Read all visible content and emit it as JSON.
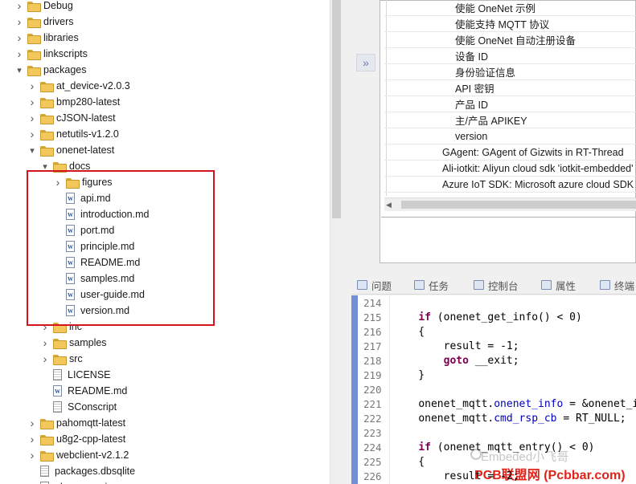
{
  "tree": {
    "items": [
      {
        "label": "Debug",
        "type": "folder",
        "expanded": false
      },
      {
        "label": "drivers",
        "type": "folder",
        "expanded": false
      },
      {
        "label": "libraries",
        "type": "folder",
        "expanded": false
      },
      {
        "label": "linkscripts",
        "type": "folder",
        "expanded": false
      },
      {
        "label": "packages",
        "type": "folder",
        "expanded": true
      },
      {
        "label": "at_device-v2.0.3",
        "type": "folder",
        "expanded": false
      },
      {
        "label": "bmp280-latest",
        "type": "folder",
        "expanded": false
      },
      {
        "label": "cJSON-latest",
        "type": "folder",
        "expanded": false
      },
      {
        "label": "netutils-v1.2.0",
        "type": "folder",
        "expanded": false
      },
      {
        "label": "onenet-latest",
        "type": "folder",
        "expanded": true
      },
      {
        "label": "docs",
        "type": "folder",
        "expanded": true
      },
      {
        "label": "figures",
        "type": "folder",
        "expanded": false
      },
      {
        "label": "api.md",
        "type": "doc"
      },
      {
        "label": "introduction.md",
        "type": "doc"
      },
      {
        "label": "port.md",
        "type": "doc"
      },
      {
        "label": "principle.md",
        "type": "doc"
      },
      {
        "label": "README.md",
        "type": "doc"
      },
      {
        "label": "samples.md",
        "type": "doc"
      },
      {
        "label": "user-guide.md",
        "type": "doc"
      },
      {
        "label": "version.md",
        "type": "doc"
      },
      {
        "label": "inc",
        "type": "folder",
        "expanded": false
      },
      {
        "label": "samples",
        "type": "folder",
        "expanded": false
      },
      {
        "label": "src",
        "type": "folder",
        "expanded": false
      },
      {
        "label": "LICENSE",
        "type": "txt"
      },
      {
        "label": "README.md",
        "type": "doc"
      },
      {
        "label": "SConscript",
        "type": "txt"
      },
      {
        "label": "pahomqtt-latest",
        "type": "folder",
        "expanded": false
      },
      {
        "label": "u8g2-cpp-latest",
        "type": "folder",
        "expanded": false
      },
      {
        "label": "webclient-v2.1.2",
        "type": "folder",
        "expanded": false
      },
      {
        "label": "packages.dbsqlite",
        "type": "txt"
      },
      {
        "label": "pkgs_error.json",
        "type": "txt"
      }
    ]
  },
  "properties": {
    "rows": [
      "使能 OneNet 示例",
      "使能支持 MQTT 协议",
      "使能 OneNet 自动注册设备",
      "设备 ID",
      "身份验证信息",
      "API 密钥",
      "产品 ID",
      "主/产品 APIKEY",
      "version",
      "GAgent: GAgent of Gizwits in RT-Thread",
      "Ali-iotkit: Aliyun cloud sdk 'iotkit-embedded' for RT-Thread",
      "Azure IoT SDK: Microsoft azure cloud SDK for RT-Thread"
    ]
  },
  "tabs": [
    "问题",
    "任务",
    "控制台",
    "属性",
    "终端"
  ],
  "editor": {
    "line_numbers": [
      "214",
      "215",
      "216",
      "217",
      "218",
      "219",
      "220",
      "221",
      "222",
      "223",
      "224",
      "225",
      "226"
    ],
    "lines": [
      "",
      "    if (onenet_get_info() < 0)",
      "    {",
      "        result = -1;",
      "        goto __exit;",
      "    }",
      "",
      "    onenet_mqtt.onenet_info = &onenet_info;",
      "    onenet_mqtt.cmd_rsp_cb = RT_NULL;",
      "",
      "    if (onenet_mqtt_entry() < 0)",
      "    {",
      "        result = -2;"
    ]
  },
  "watermark": {
    "line1": "Embeded小飞哥",
    "line2": "PCB联盟网 (Pcbbar.com)"
  },
  "icons": {
    "collapse": "double-chevron-right-icon"
  },
  "colors": {
    "highlight_box": "#d4161c",
    "keyword": "#7f0055",
    "field": "#0000c0",
    "gutter_accent": "#6f8fd8"
  }
}
